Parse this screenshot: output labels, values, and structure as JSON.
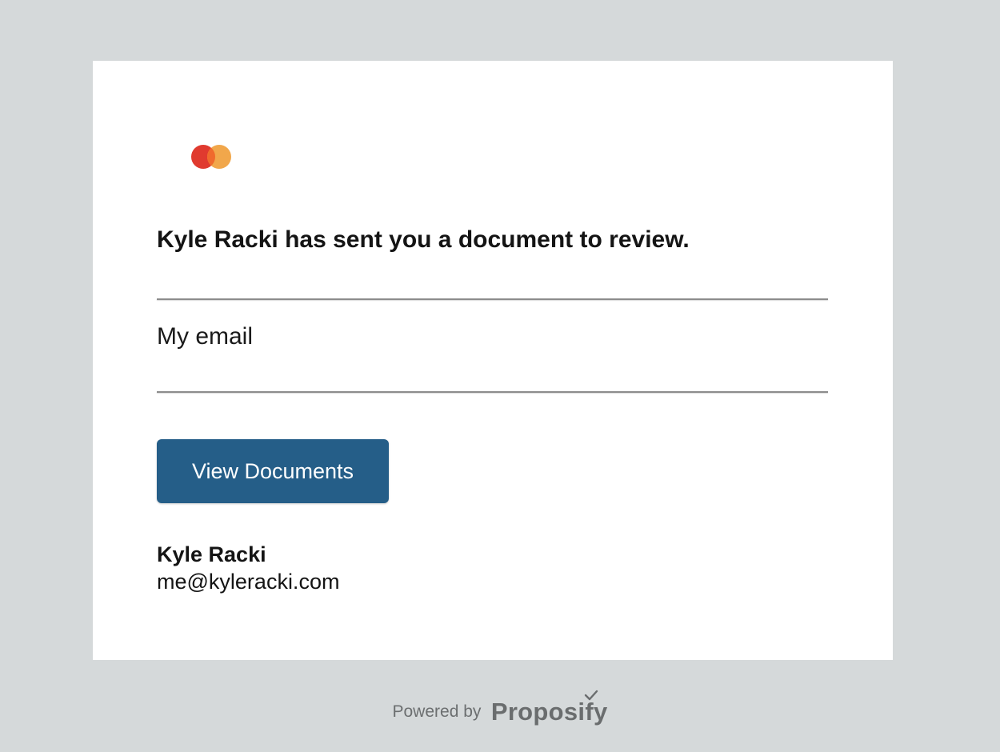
{
  "email": {
    "headline": "Kyle Racki has sent you a document to review.",
    "subject": "My email",
    "view_button_label": "View Documents",
    "sender": {
      "name": "Kyle Racki",
      "email": "me@kyleracki.com"
    }
  },
  "footer": {
    "powered_by": "Powered by",
    "brand": "Proposify"
  },
  "icons": {
    "logo": "two-overlapping-circles-logo",
    "brand_mark": "checkmark-icon"
  },
  "colors": {
    "background": "#d5d9da",
    "card": "#ffffff",
    "button": "#255e88",
    "logo_red": "#e03a2f",
    "logo_orange": "#f0a03c"
  }
}
